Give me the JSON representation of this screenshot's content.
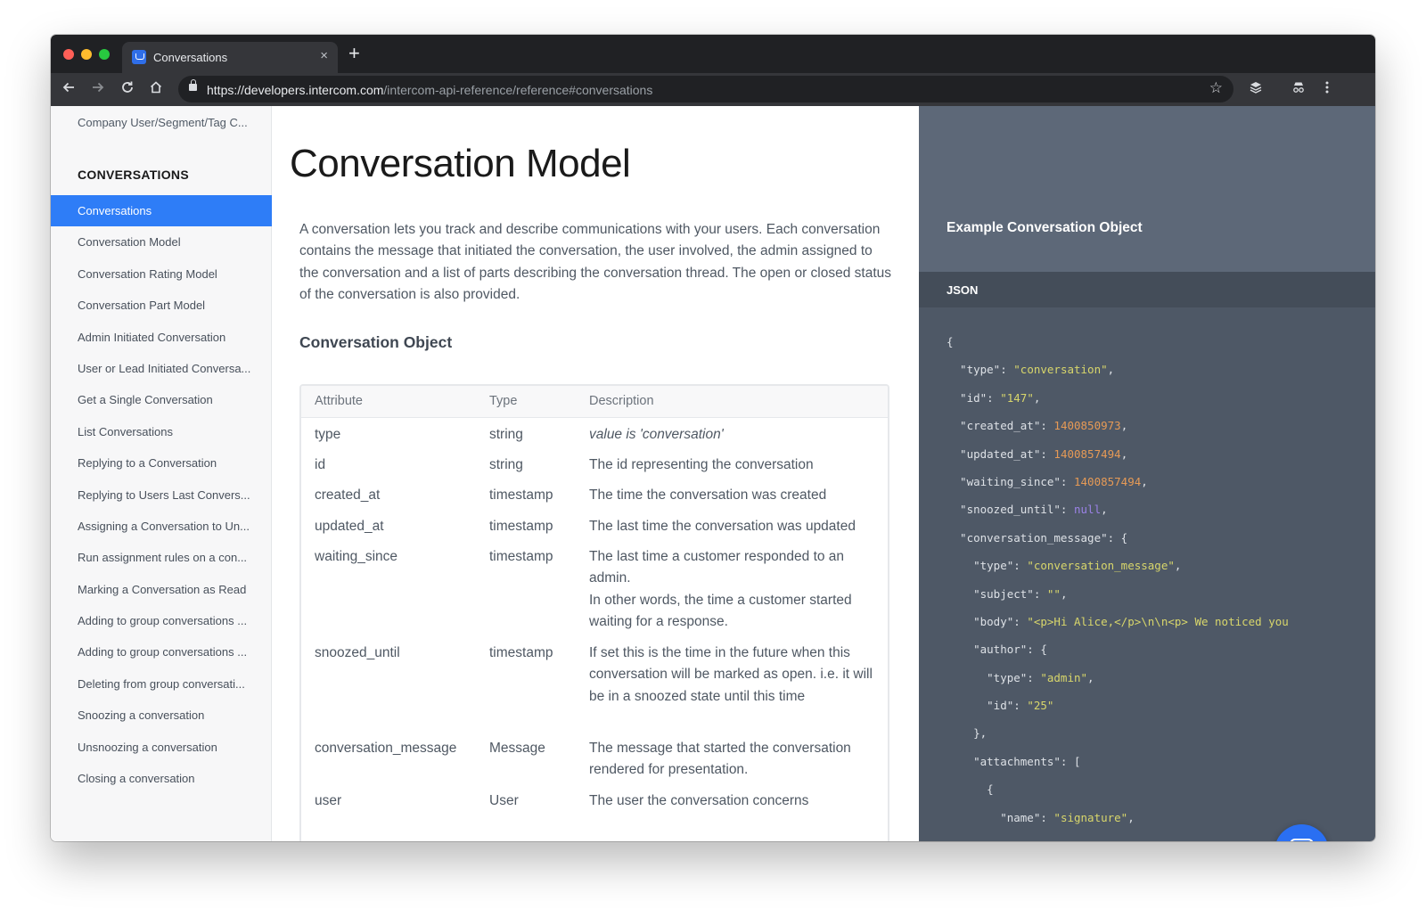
{
  "browser": {
    "tab_title": "Conversations",
    "tab_close": "×",
    "new_tab": "+",
    "url_host": "https://developers.intercom.com",
    "url_path": "/intercom-api-reference/reference#conversations"
  },
  "sidebar": {
    "top_item": "Company User/Segment/Tag C...",
    "section_heading": "CONVERSATIONS",
    "items": [
      {
        "label": "Conversations",
        "active": true
      },
      {
        "label": "Conversation Model"
      },
      {
        "label": "Conversation Rating Model"
      },
      {
        "label": "Conversation Part Model"
      },
      {
        "label": "Admin Initiated Conversation"
      },
      {
        "label": "User or Lead Initiated Conversa..."
      },
      {
        "label": "Get a Single Conversation"
      },
      {
        "label": "List Conversations"
      },
      {
        "label": "Replying to a Conversation"
      },
      {
        "label": "Replying to Users Last Convers..."
      },
      {
        "label": "Assigning a Conversation to Un..."
      },
      {
        "label": "Run assignment rules on a con..."
      },
      {
        "label": "Marking a Conversation as Read"
      },
      {
        "label": "Adding to group conversations ..."
      },
      {
        "label": "Adding to group conversations ..."
      },
      {
        "label": "Deleting from group conversati..."
      },
      {
        "label": "Snoozing a conversation"
      },
      {
        "label": "Unsnoozing a conversation"
      },
      {
        "label": "Closing a conversation"
      }
    ]
  },
  "main": {
    "title": "Conversation Model",
    "intro": "A conversation lets you track and describe communications with your users. Each conversation contains the message that initiated the conversation, the user involved, the admin assigned to the conversation and a list of parts describing the conversation thread. The open or closed status of the conversation is also provided.",
    "section_title": "Conversation Object",
    "table": {
      "headers": [
        "Attribute",
        "Type",
        "Description"
      ],
      "rows": [
        {
          "attribute": "type",
          "type": "string",
          "description": "value is 'conversation'"
        },
        {
          "attribute": "id",
          "type": "string",
          "description": "The id representing the conversation"
        },
        {
          "attribute": "created_at",
          "type": "timestamp",
          "description": "The time the conversation was created"
        },
        {
          "attribute": "updated_at",
          "type": "timestamp",
          "description": "The last time the conversation was updated"
        },
        {
          "attribute": "waiting_since",
          "type": "timestamp",
          "description": "The last time a customer responded to an admin.",
          "description_2": "In other words, the time a customer started waiting for a response."
        },
        {
          "attribute": "snoozed_until",
          "type": "timestamp",
          "description": "If set this is the time in the future when this conversation will be marked as open. i.e. it will be in a snoozed state until this time"
        },
        {
          "attribute": "conversation_message",
          "type": "Message",
          "description": "The message that started the conversation rendered for presentation."
        },
        {
          "attribute": "user",
          "type": "User",
          "description": "The user the conversation concerns"
        }
      ]
    }
  },
  "example": {
    "title": "Example Conversation Object",
    "tab_label": "JSON",
    "code_lines": [
      [
        {
          "t": "p",
          "s": "{"
        }
      ],
      [
        {
          "t": "p",
          "s": "  \"type\": "
        },
        {
          "t": "s",
          "s": "\"conversation\""
        },
        {
          "t": "p",
          "s": ","
        }
      ],
      [
        {
          "t": "p",
          "s": "  \"id\": "
        },
        {
          "t": "s",
          "s": "\"147\""
        },
        {
          "t": "p",
          "s": ","
        }
      ],
      [
        {
          "t": "p",
          "s": "  \"created_at\": "
        },
        {
          "t": "n",
          "s": "1400850973"
        },
        {
          "t": "p",
          "s": ","
        }
      ],
      [
        {
          "t": "p",
          "s": "  \"updated_at\": "
        },
        {
          "t": "n",
          "s": "1400857494"
        },
        {
          "t": "p",
          "s": ","
        }
      ],
      [
        {
          "t": "p",
          "s": "  \"waiting_since\": "
        },
        {
          "t": "n",
          "s": "1400857494"
        },
        {
          "t": "p",
          "s": ","
        }
      ],
      [
        {
          "t": "p",
          "s": "  \"snoozed_until\": "
        },
        {
          "t": "x",
          "s": "null"
        },
        {
          "t": "p",
          "s": ","
        }
      ],
      [
        {
          "t": "p",
          "s": "  \"conversation_message\": {"
        }
      ],
      [
        {
          "t": "p",
          "s": "    \"type\": "
        },
        {
          "t": "s",
          "s": "\"conversation_message\""
        },
        {
          "t": "p",
          "s": ","
        }
      ],
      [
        {
          "t": "p",
          "s": "    \"subject\": "
        },
        {
          "t": "s",
          "s": "\"\""
        },
        {
          "t": "p",
          "s": ","
        }
      ],
      [
        {
          "t": "p",
          "s": "    \"body\": "
        },
        {
          "t": "s",
          "s": "\"<p>Hi Alice,</p>\\n\\n<p> We noticed you"
        }
      ],
      [
        {
          "t": "p",
          "s": "    \"author\": {"
        }
      ],
      [
        {
          "t": "p",
          "s": "      \"type\": "
        },
        {
          "t": "s",
          "s": "\"admin\""
        },
        {
          "t": "p",
          "s": ","
        }
      ],
      [
        {
          "t": "p",
          "s": "      \"id\": "
        },
        {
          "t": "s",
          "s": "\"25\""
        }
      ],
      [
        {
          "t": "p",
          "s": "    },"
        }
      ],
      [
        {
          "t": "p",
          "s": "    \"attachments\": ["
        }
      ],
      [
        {
          "t": "p",
          "s": "      {"
        }
      ],
      [
        {
          "t": "p",
          "s": "        \"name\": "
        },
        {
          "t": "s",
          "s": "\"signature\""
        },
        {
          "t": "p",
          "s": ","
        }
      ]
    ]
  },
  "colors": {
    "accent": "#2e7df7",
    "code_string": "#d8d66b",
    "code_number": "#e69a56",
    "code_null": "#9b82e6",
    "side_panel": "#4e5866"
  }
}
